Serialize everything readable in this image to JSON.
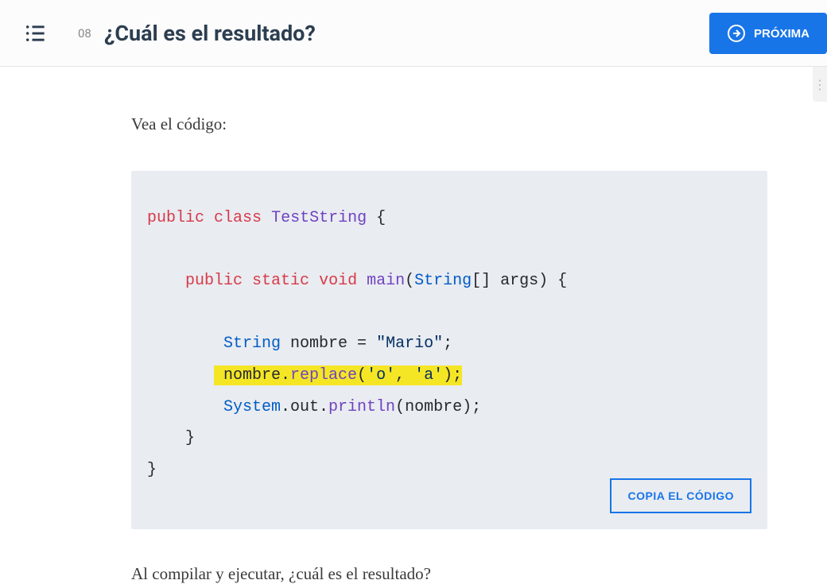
{
  "header": {
    "lesson_number": "08",
    "lesson_title": "¿Cuál es el resultado?",
    "next_button": "PRÓXIMA"
  },
  "content": {
    "intro": "Vea el código:",
    "outro": "Al compilar y ejecutar, ¿cuál es el resultado?"
  },
  "code": {
    "copy_label": "COPIA EL CÓDIGO",
    "kw_public": "public",
    "kw_class": "class",
    "class_name": "TestString",
    "brace_open": " {",
    "kw_static": "static",
    "kw_void": "void",
    "method_main": "main",
    "type_string": "String",
    "args_sig": "[] args) {",
    "var_decl_pre": " nombre = ",
    "str_mario": "\"Mario\"",
    "semi": ";",
    "hl_pre": " nombre.",
    "hl_method": "replace",
    "hl_open": "(",
    "hl_char1": "'o'",
    "hl_comma": ", ",
    "hl_char2": "'a'",
    "hl_close": ");",
    "sys": "System",
    "dot_out": ".out.",
    "println": "println",
    "println_arg": "(nombre);",
    "brace_close_inner": "    }",
    "brace_close_outer": "}"
  }
}
